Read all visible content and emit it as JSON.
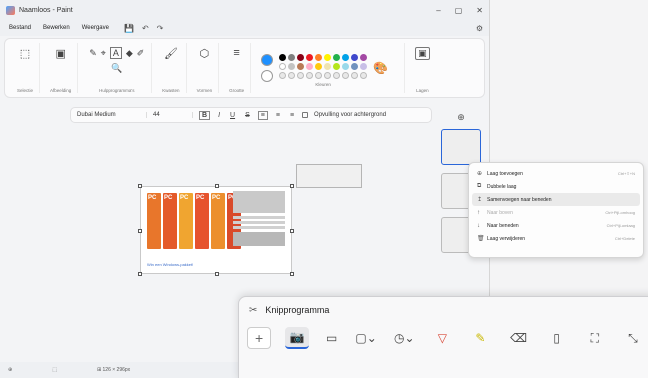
{
  "paint": {
    "window_title": "Naamloos - Paint",
    "window_controls": [
      "–",
      "▢",
      "✕"
    ],
    "menu": [
      "Bestand",
      "Bewerken",
      "Weergave"
    ],
    "quick_access": [
      "💾",
      "↶",
      "↷"
    ],
    "ribbon_groups": [
      {
        "label": "Selectie",
        "glyphs": [
          "⬚"
        ]
      },
      {
        "label": "Afbeelding",
        "glyphs": [
          "▣"
        ]
      },
      {
        "label": "Hulpprogramma's",
        "glyphs": [
          "✎",
          "⌖",
          "A",
          "◆",
          "✐",
          "🔍"
        ]
      },
      {
        "label": "Kwasten",
        "glyphs": [
          "🖌"
        ]
      },
      {
        "label": "Vormen",
        "glyphs": [
          "⬡"
        ]
      },
      {
        "label": "Grootte",
        "glyphs": [
          "≡"
        ]
      }
    ],
    "colors_label": "Kleuren",
    "layers_label": "Lagen",
    "swatch_colors": [
      "#000000",
      "#7f7f7f",
      "#880015",
      "#ed1c24",
      "#ff7f27",
      "#fff200",
      "#22b14c",
      "#00a2e8",
      "#3f48cc",
      "#a349a4",
      "#ffffff",
      "#c3c3c3",
      "#b97a57",
      "#ffaec9",
      "#ffc90e",
      "#efe4b0",
      "#b5e61d",
      "#99d9ea",
      "#7092be",
      "#c8bfe7",
      "#e8e8e8",
      "#e8e8e8",
      "#e8e8e8",
      "#e8e8e8",
      "#e8e8e8",
      "#e8e8e8",
      "#e8e8e8",
      "#e8e8e8",
      "#e8e8e8",
      "#e8e8e8"
    ],
    "textbar": {
      "font": "Dubai Medium",
      "size": "44",
      "bold": "B",
      "italic": "I",
      "underline": "U",
      "strike": "S",
      "align": "≡",
      "fill_label": "Opvulling voor achtergrond"
    },
    "doc_caption": "Win een Windows-pakket!",
    "statusbar": [
      "⊕",
      "⬚",
      "⊞ 126 × 296px"
    ],
    "layer_add": "⊕"
  },
  "context_menu": {
    "items": [
      {
        "icon": "⊕",
        "label": "Laag toevoegen",
        "shortcut": "Ctrl+⇧+N",
        "state": "normal"
      },
      {
        "icon": "⧉",
        "label": "Dubbele laag",
        "shortcut": "",
        "state": "normal"
      },
      {
        "icon": "↥",
        "label": "Samenvoegen naar beneden",
        "shortcut": "",
        "state": "hover"
      },
      {
        "icon": "↑",
        "label": "Naar boven",
        "shortcut": "Ctrl+Pijl-omhoog",
        "state": "disabled"
      },
      {
        "icon": "↓",
        "label": "Naar beneden",
        "shortcut": "Ctrl+Pijl-omlaag",
        "state": "normal"
      },
      {
        "icon": "🗑",
        "label": "Laag verwijderen",
        "shortcut": "Ctrl+Delete",
        "state": "normal"
      }
    ]
  },
  "snip": {
    "title": "Knipprogramma",
    "tools": [
      "+",
      "📷",
      "▭",
      "▢⌄",
      "◷⌄",
      "▽",
      "✎",
      "⌫",
      "▯",
      "⛶",
      "⤡"
    ]
  }
}
